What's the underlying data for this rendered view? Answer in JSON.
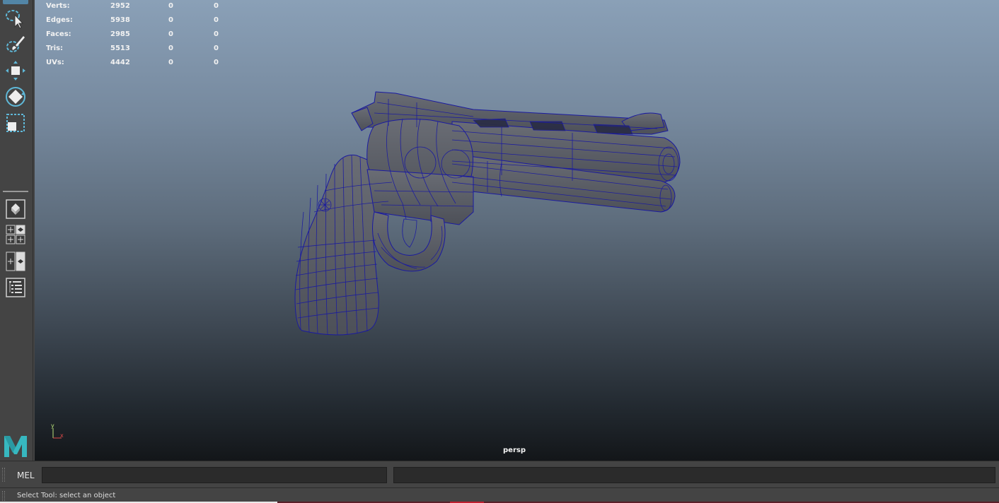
{
  "toolbox": {
    "tools": [
      {
        "name": "select-tool",
        "icon": "select-arrow-icon"
      },
      {
        "name": "lasso-tool",
        "icon": "lasso-icon"
      },
      {
        "name": "paint-select-tool",
        "icon": "paint-brush-icon"
      },
      {
        "name": "move-tool",
        "icon": "move-arrows-icon"
      },
      {
        "name": "rotate-tool",
        "icon": "rotate-icon"
      },
      {
        "name": "scale-tool",
        "icon": "scale-icon"
      }
    ],
    "layouts": [
      "single-perspective-layout",
      "four-view-layout",
      "two-view-layout",
      "outliner-layout"
    ],
    "logo": "maya-logo"
  },
  "hud": {
    "rows": [
      {
        "label": "Verts:",
        "v1": "2952",
        "v2": "0",
        "v3": "0"
      },
      {
        "label": "Edges:",
        "v1": "5938",
        "v2": "0",
        "v3": "0"
      },
      {
        "label": "Faces:",
        "v1": "2985",
        "v2": "0",
        "v3": "0"
      },
      {
        "label": "Tris:",
        "v1": "5513",
        "v2": "0",
        "v3": "0"
      },
      {
        "label": "UVs:",
        "v1": "4442",
        "v2": "0",
        "v3": "0"
      }
    ]
  },
  "viewport": {
    "camera": "persp",
    "axis_y": "y",
    "axis_x": "x"
  },
  "cmdline": {
    "language": "MEL",
    "input_value": "",
    "output_value": ""
  },
  "helpline": {
    "text": "Select Tool: select an object"
  },
  "colors": {
    "accent": "#5285a6",
    "wireframe": "#1a1aa0",
    "mesh": "#5d6068",
    "logo": "#37b8c0"
  }
}
